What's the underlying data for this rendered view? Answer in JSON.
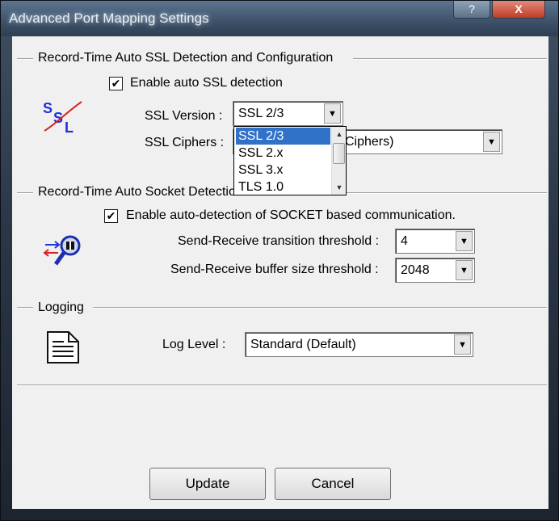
{
  "window": {
    "title": "Advanced Port Mapping Settings",
    "help_label": "?",
    "close_label": "X"
  },
  "ssl_group": {
    "title": "Record-Time Auto SSL Detection and Configuration",
    "enable_label": "Enable auto SSL detection",
    "enable_checked": true,
    "checkmark": "✔",
    "version_label": "SSL Version :",
    "version_value": "SSL 2/3",
    "ciphers_label": "SSL Ciphers :",
    "ciphers_value_visible": "Ciphers)",
    "version_options": [
      "SSL 2/3",
      "SSL 2.x",
      "SSL 3.x",
      "TLS 1.0"
    ],
    "selected_option": "SSL 2/3"
  },
  "socket_group": {
    "title": "Record-Time Auto Socket Detection",
    "enable_label": "Enable auto-detection of SOCKET based communication.",
    "enable_checked": true,
    "checkmark": "✔",
    "transition_label": "Send-Receive transition threshold :",
    "transition_value": "4",
    "buffer_label": "Send-Receive buffer size threshold :",
    "buffer_value": "2048"
  },
  "logging_group": {
    "title": "Logging",
    "level_label": "Log Level :",
    "level_value": "Standard (Default)"
  },
  "buttons": {
    "update": "Update",
    "cancel": "Cancel"
  },
  "icons": {
    "ssl": "ssl-icon",
    "socket": "socket-detect-icon",
    "log": "log-document-icon",
    "dropdown_arrow": "▼",
    "scroll_up": "▲",
    "scroll_down": "▼"
  }
}
